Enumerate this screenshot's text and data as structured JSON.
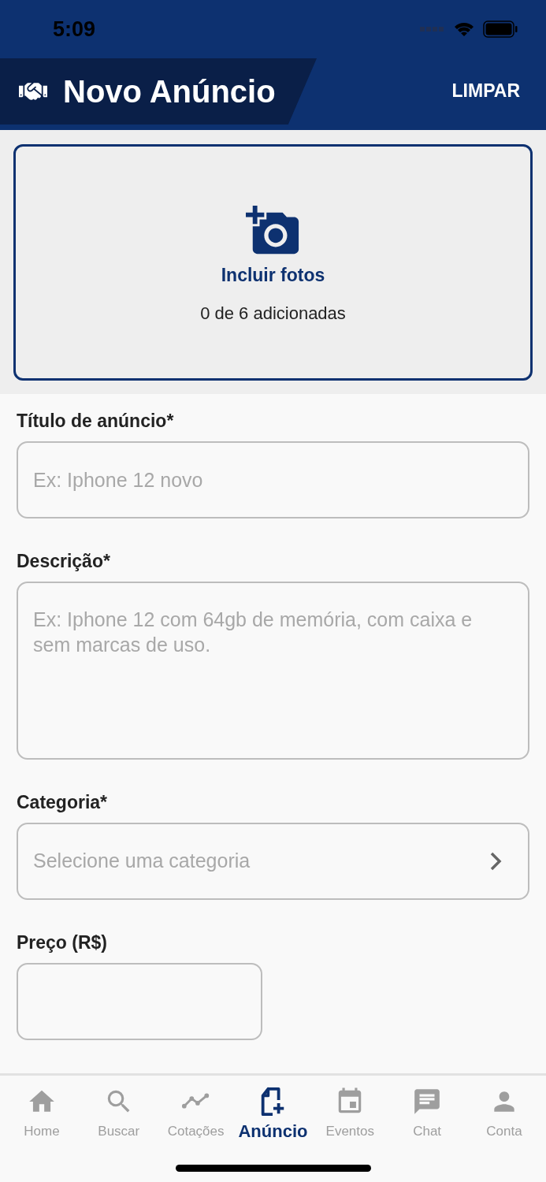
{
  "status_bar": {
    "time": "5:09"
  },
  "header": {
    "title": "Novo Anúncio",
    "action": "LIMPAR"
  },
  "photos": {
    "label": "Incluir fotos",
    "count": "0 de 6 adicionadas"
  },
  "form": [
    {
      "kind": "text",
      "label": "Título de anúncio*",
      "placeholder": "Ex: Iphone 12 novo"
    },
    {
      "kind": "textarea",
      "label": "Descrição*",
      "placeholder": "Ex: Iphone 12 com 64gb de memória, com caixa e sem marcas de uso."
    },
    {
      "kind": "select",
      "label": "Categoria*",
      "placeholder": "Selecione uma categoria"
    },
    {
      "kind": "price",
      "label": "Preço (R$)"
    }
  ],
  "tab_bar": [
    {
      "kind": "home",
      "label": "Home",
      "selected": false
    },
    {
      "kind": "search",
      "label": "Buscar",
      "selected": false
    },
    {
      "kind": "chart",
      "label": "Cotações",
      "selected": false
    },
    {
      "kind": "ad",
      "label": "Anúncio",
      "selected": true
    },
    {
      "kind": "calendar",
      "label": "Eventos",
      "selected": false
    },
    {
      "kind": "chat",
      "label": "Chat",
      "selected": false
    },
    {
      "kind": "person",
      "label": "Conta",
      "selected": false
    }
  ]
}
